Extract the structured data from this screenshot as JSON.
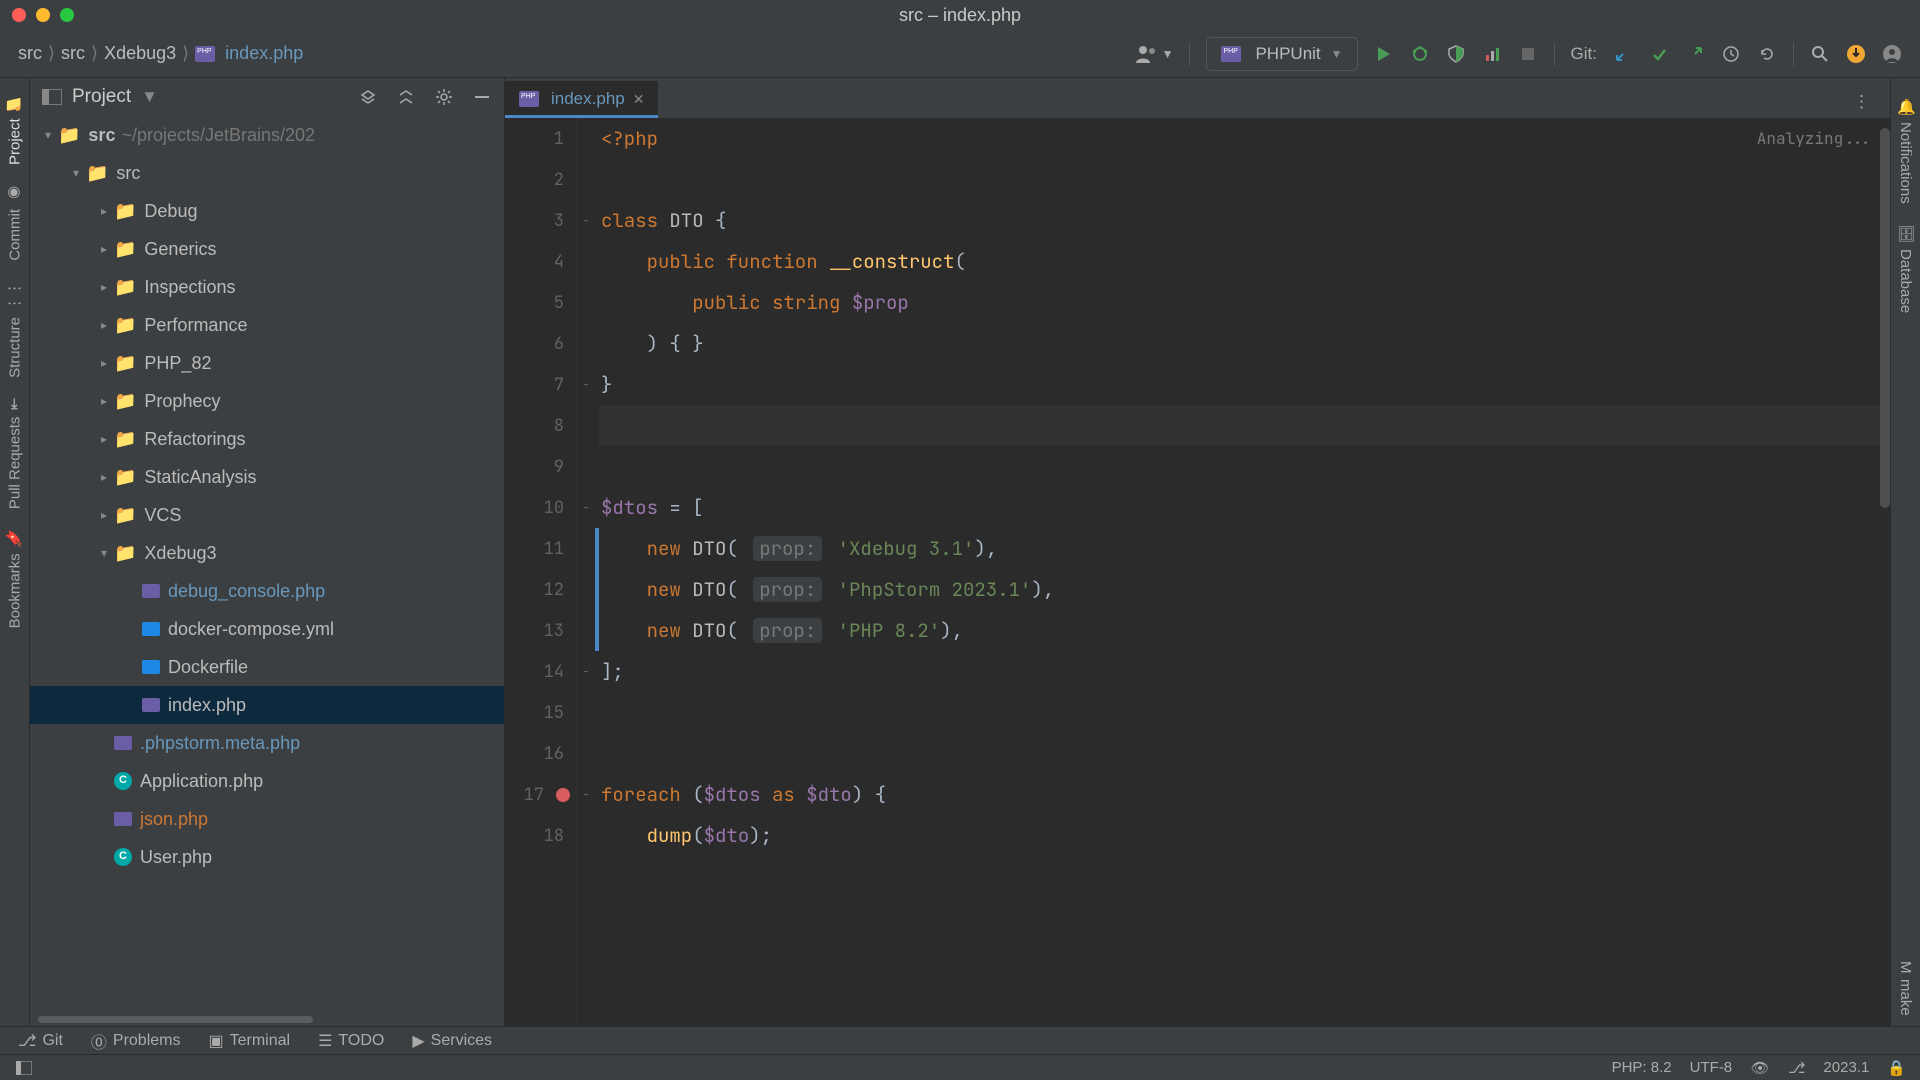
{
  "window": {
    "title": "src – index.php"
  },
  "breadcrumb": {
    "a": "src",
    "b": "src",
    "c": "Xdebug3",
    "d": "index.php",
    "sep": "⟩"
  },
  "run_config": {
    "label": "PHPUnit"
  },
  "git_label": "Git:",
  "project_panel": {
    "title": "Project"
  },
  "tree": {
    "root": "src",
    "root_path": "~/projects/JetBrains/202",
    "items": [
      {
        "name": "src",
        "kind": "folder",
        "indent": 1,
        "expanded": true
      },
      {
        "name": "Debug",
        "kind": "folder",
        "indent": 2,
        "collapsed": true
      },
      {
        "name": "Generics",
        "kind": "folder",
        "indent": 2,
        "collapsed": true
      },
      {
        "name": "Inspections",
        "kind": "folder",
        "indent": 2,
        "collapsed": true
      },
      {
        "name": "Performance",
        "kind": "folder",
        "indent": 2,
        "collapsed": true
      },
      {
        "name": "PHP_82",
        "kind": "folder",
        "indent": 2,
        "collapsed": true
      },
      {
        "name": "Prophecy",
        "kind": "folder",
        "indent": 2,
        "collapsed": true
      },
      {
        "name": "Refactorings",
        "kind": "folder",
        "indent": 2,
        "collapsed": true
      },
      {
        "name": "StaticAnalysis",
        "kind": "folder",
        "indent": 2,
        "collapsed": true
      },
      {
        "name": "VCS",
        "kind": "folder",
        "indent": 2,
        "collapsed": true
      },
      {
        "name": "Xdebug3",
        "kind": "folder",
        "indent": 2,
        "expanded": true
      },
      {
        "name": "debug_console.php",
        "kind": "php",
        "indent": 3,
        "color": "blue"
      },
      {
        "name": "docker-compose.yml",
        "kind": "dc",
        "indent": 3
      },
      {
        "name": "Dockerfile",
        "kind": "d",
        "indent": 3
      },
      {
        "name": "index.php",
        "kind": "php",
        "indent": 3,
        "selected": true
      },
      {
        "name": ".phpstorm.meta.php",
        "kind": "php",
        "indent": 2,
        "color": "blue"
      },
      {
        "name": "Application.php",
        "kind": "class",
        "indent": 2
      },
      {
        "name": "json.php",
        "kind": "php",
        "indent": 2,
        "color": "orange"
      },
      {
        "name": "User.php",
        "kind": "class",
        "indent": 2
      }
    ]
  },
  "tab": {
    "name": "index.php"
  },
  "analyzing": "Analyzing...",
  "code": {
    "lines": [
      "1",
      "2",
      "3",
      "4",
      "5",
      "6",
      "7",
      "8",
      "9",
      "10",
      "11",
      "12",
      "13",
      "14",
      "15",
      "16",
      "17",
      "18"
    ],
    "l1": {
      "a": "<?php"
    },
    "l3": {
      "a": "class ",
      "b": "DTO ",
      "c": "{"
    },
    "l4": {
      "a": "    public function ",
      "b": "__construct",
      "c": "("
    },
    "l5": {
      "a": "        public ",
      "b": "string ",
      "c": "$prop"
    },
    "l6": {
      "a": "    ) { }"
    },
    "l7": {
      "a": "}"
    },
    "l10": {
      "a": "$dtos ",
      "b": "= ["
    },
    "l11": {
      "a": "    new ",
      "b": "DTO",
      "c": "( ",
      "h": "prop:",
      "d": " 'Xdebug 3.1'",
      "e": "),"
    },
    "l12": {
      "a": "    new ",
      "b": "DTO",
      "c": "( ",
      "h": "prop:",
      "d": " 'PhpStorm 2023.1'",
      "e": "),"
    },
    "l13": {
      "a": "    new ",
      "b": "DTO",
      "c": "( ",
      "h": "prop:",
      "d": " 'PHP 8.2'",
      "e": "),"
    },
    "l14": {
      "a": "];"
    },
    "l17": {
      "a": "foreach ",
      "b": "(",
      "c": "$dtos ",
      "d": "as ",
      "e": "$dto",
      "f": ") {"
    },
    "l18": {
      "a": "    ",
      "b": "dump",
      "c": "(",
      "d": "$dto",
      "e": ");"
    }
  },
  "bottom": {
    "git": "Git",
    "problems": "Problems",
    "terminal": "Terminal",
    "todo": "TODO",
    "services": "Services"
  },
  "status": {
    "php": "PHP: 8.2",
    "enc": "UTF-8",
    "ver": "2023.1"
  },
  "gutter_left": {
    "project": "Project",
    "commit": "Commit",
    "structure": "Structure",
    "pr": "Pull Requests",
    "bm": "Bookmarks"
  },
  "gutter_right": {
    "not": "Notifications",
    "db": "Database",
    "make": "make"
  }
}
